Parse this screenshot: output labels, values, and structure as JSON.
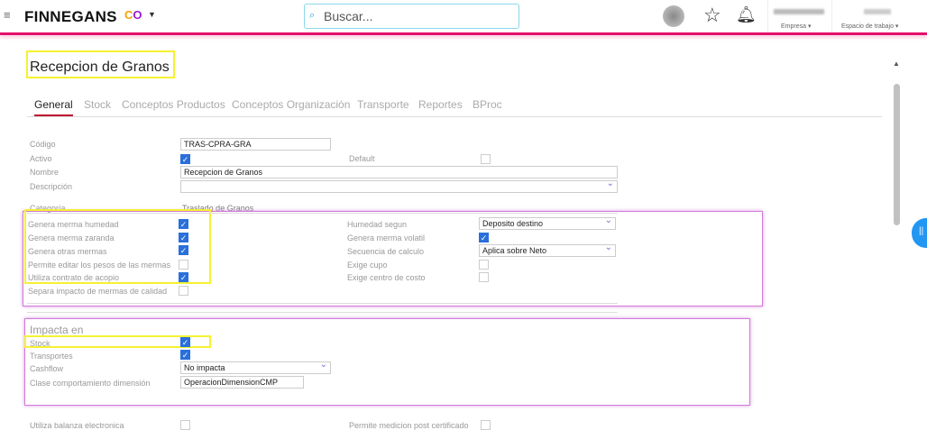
{
  "header": {
    "brand": "FINNEGANS",
    "search_placeholder": "Buscar...",
    "empresa": "Empresa ▾",
    "espacio": "Espacio de trabajo ▾"
  },
  "title": "Recepcion de Granos",
  "tabs": [
    "General",
    "Stock",
    "Conceptos Productos",
    "Conceptos Organización",
    "Transporte",
    "Reportes",
    "BProc"
  ],
  "form": {
    "codigo": {
      "label": "Código",
      "value": "TRAS-CPRA-GRA"
    },
    "activo": {
      "label": "Activo",
      "checked": true
    },
    "default": {
      "label": "Default",
      "checked": false
    },
    "nombre": {
      "label": "Nombre",
      "value": "Recepcion de Granos"
    },
    "descripcion": {
      "label": "Descripción",
      "value": ""
    },
    "categoria": {
      "label": "Categoría",
      "value": "Traslado de Granos"
    },
    "left": [
      {
        "label": "Genera merma humedad",
        "checked": true
      },
      {
        "label": "Genera merma zaranda",
        "checked": true
      },
      {
        "label": "Genera otras mermas",
        "checked": true
      },
      {
        "label": "Permite editar los pesos de las mermas",
        "checked": false
      },
      {
        "label": "Utiliza contrato de acopio",
        "checked": true
      },
      {
        "label": "Separa impacto de mermas de calidad",
        "checked": false
      }
    ],
    "humedad_segun": {
      "label": "Humedad segun",
      "value": "Deposito destino"
    },
    "genera_merma_volatil": {
      "label": "Genera merma volatil",
      "checked": true
    },
    "secuencia": {
      "label": "Secuencia de calculo",
      "value": "Aplica sobre Neto"
    },
    "exige_cupo": {
      "label": "Exige cupo",
      "checked": false
    },
    "exige_centro": {
      "label": "Exige centro de costo",
      "checked": false
    }
  },
  "impacta": {
    "title": "Impacta en",
    "stock": {
      "label": "Stock",
      "checked": true
    },
    "transportes": {
      "label": "Transportes",
      "checked": true
    },
    "cashflow": {
      "label": "Cashflow",
      "value": "No impacta"
    },
    "clase": {
      "label": "Clase comportamiento dimensión",
      "value": "OperacionDimensionCMP"
    }
  },
  "bottom": {
    "balanza": {
      "label": "Utiliza balanza electronica",
      "checked": false
    },
    "medicion": {
      "label": "Permite medicion post certificado",
      "checked": false
    }
  }
}
